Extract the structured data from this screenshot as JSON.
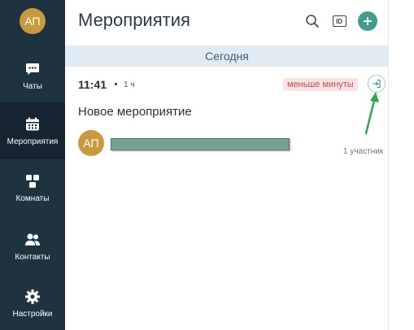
{
  "user": {
    "initials": "АП"
  },
  "sidebar": {
    "items": [
      {
        "label": "Чаты",
        "icon": "chat-icon"
      },
      {
        "label": "Мероприятия",
        "icon": "calendar-icon",
        "active": true
      },
      {
        "label": "Комнаты",
        "icon": "rooms-icon"
      },
      {
        "label": "Контакты",
        "icon": "contacts-icon"
      },
      {
        "label": "Настройки",
        "icon": "gear-icon"
      }
    ]
  },
  "header": {
    "title": "Мероприятия",
    "search_icon": "search-icon",
    "id_label": "ID",
    "add_icon": "plus-icon"
  },
  "date_divider": "Сегодня",
  "event": {
    "time": "11:41",
    "duration": "1 ч",
    "badge": "меньше минуты",
    "join_icon": "enter-icon",
    "title": "Новое мероприятие",
    "participant_initials": "АП",
    "participants_count": "1 участник"
  },
  "colors": {
    "sidebar_bg": "#1f3240",
    "accent": "#3f9e8f",
    "avatar": "#c99a3c",
    "badge_bg": "#fbe3e4",
    "badge_text": "#c74a50",
    "annotation_arrow": "#2fa84a"
  }
}
